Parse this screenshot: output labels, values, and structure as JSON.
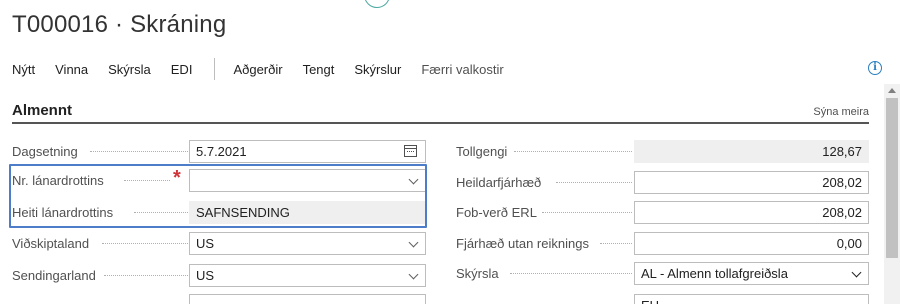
{
  "page": {
    "title": "T000016 · Skráning"
  },
  "actions": {
    "items": [
      "Nýtt",
      "Vinna",
      "Skýrsla",
      "EDI"
    ],
    "items2": [
      "Aðgerðir",
      "Tengt",
      "Skýrslur"
    ],
    "fewer": "Færri valkostir"
  },
  "section": {
    "title": "Almennt",
    "show_more": "Sýna meira"
  },
  "left_fields": [
    {
      "label": "Dagsetning",
      "value": "5.7.2021"
    },
    {
      "label": "Nr. lánardrottins",
      "value": ""
    },
    {
      "label": "Heiti lánardrottins",
      "value": "SAFNSENDING"
    },
    {
      "label": "Viðskiptaland",
      "value": "US"
    },
    {
      "label": "Sendingarland",
      "value": "US"
    }
  ],
  "right_fields": [
    {
      "label": "Tollgengi",
      "value": "128,67"
    },
    {
      "label": "Heildarfjárhæð",
      "value": "208,02"
    },
    {
      "label": "Fob-verð ERL",
      "value": "208,02"
    },
    {
      "label": "Fjárhæð utan reiknings",
      "value": "0,00"
    },
    {
      "label": "Skýrsla",
      "value": "AL - Almenn tollafgreiðsla"
    }
  ],
  "partial_row": {
    "right_value": "EU"
  }
}
